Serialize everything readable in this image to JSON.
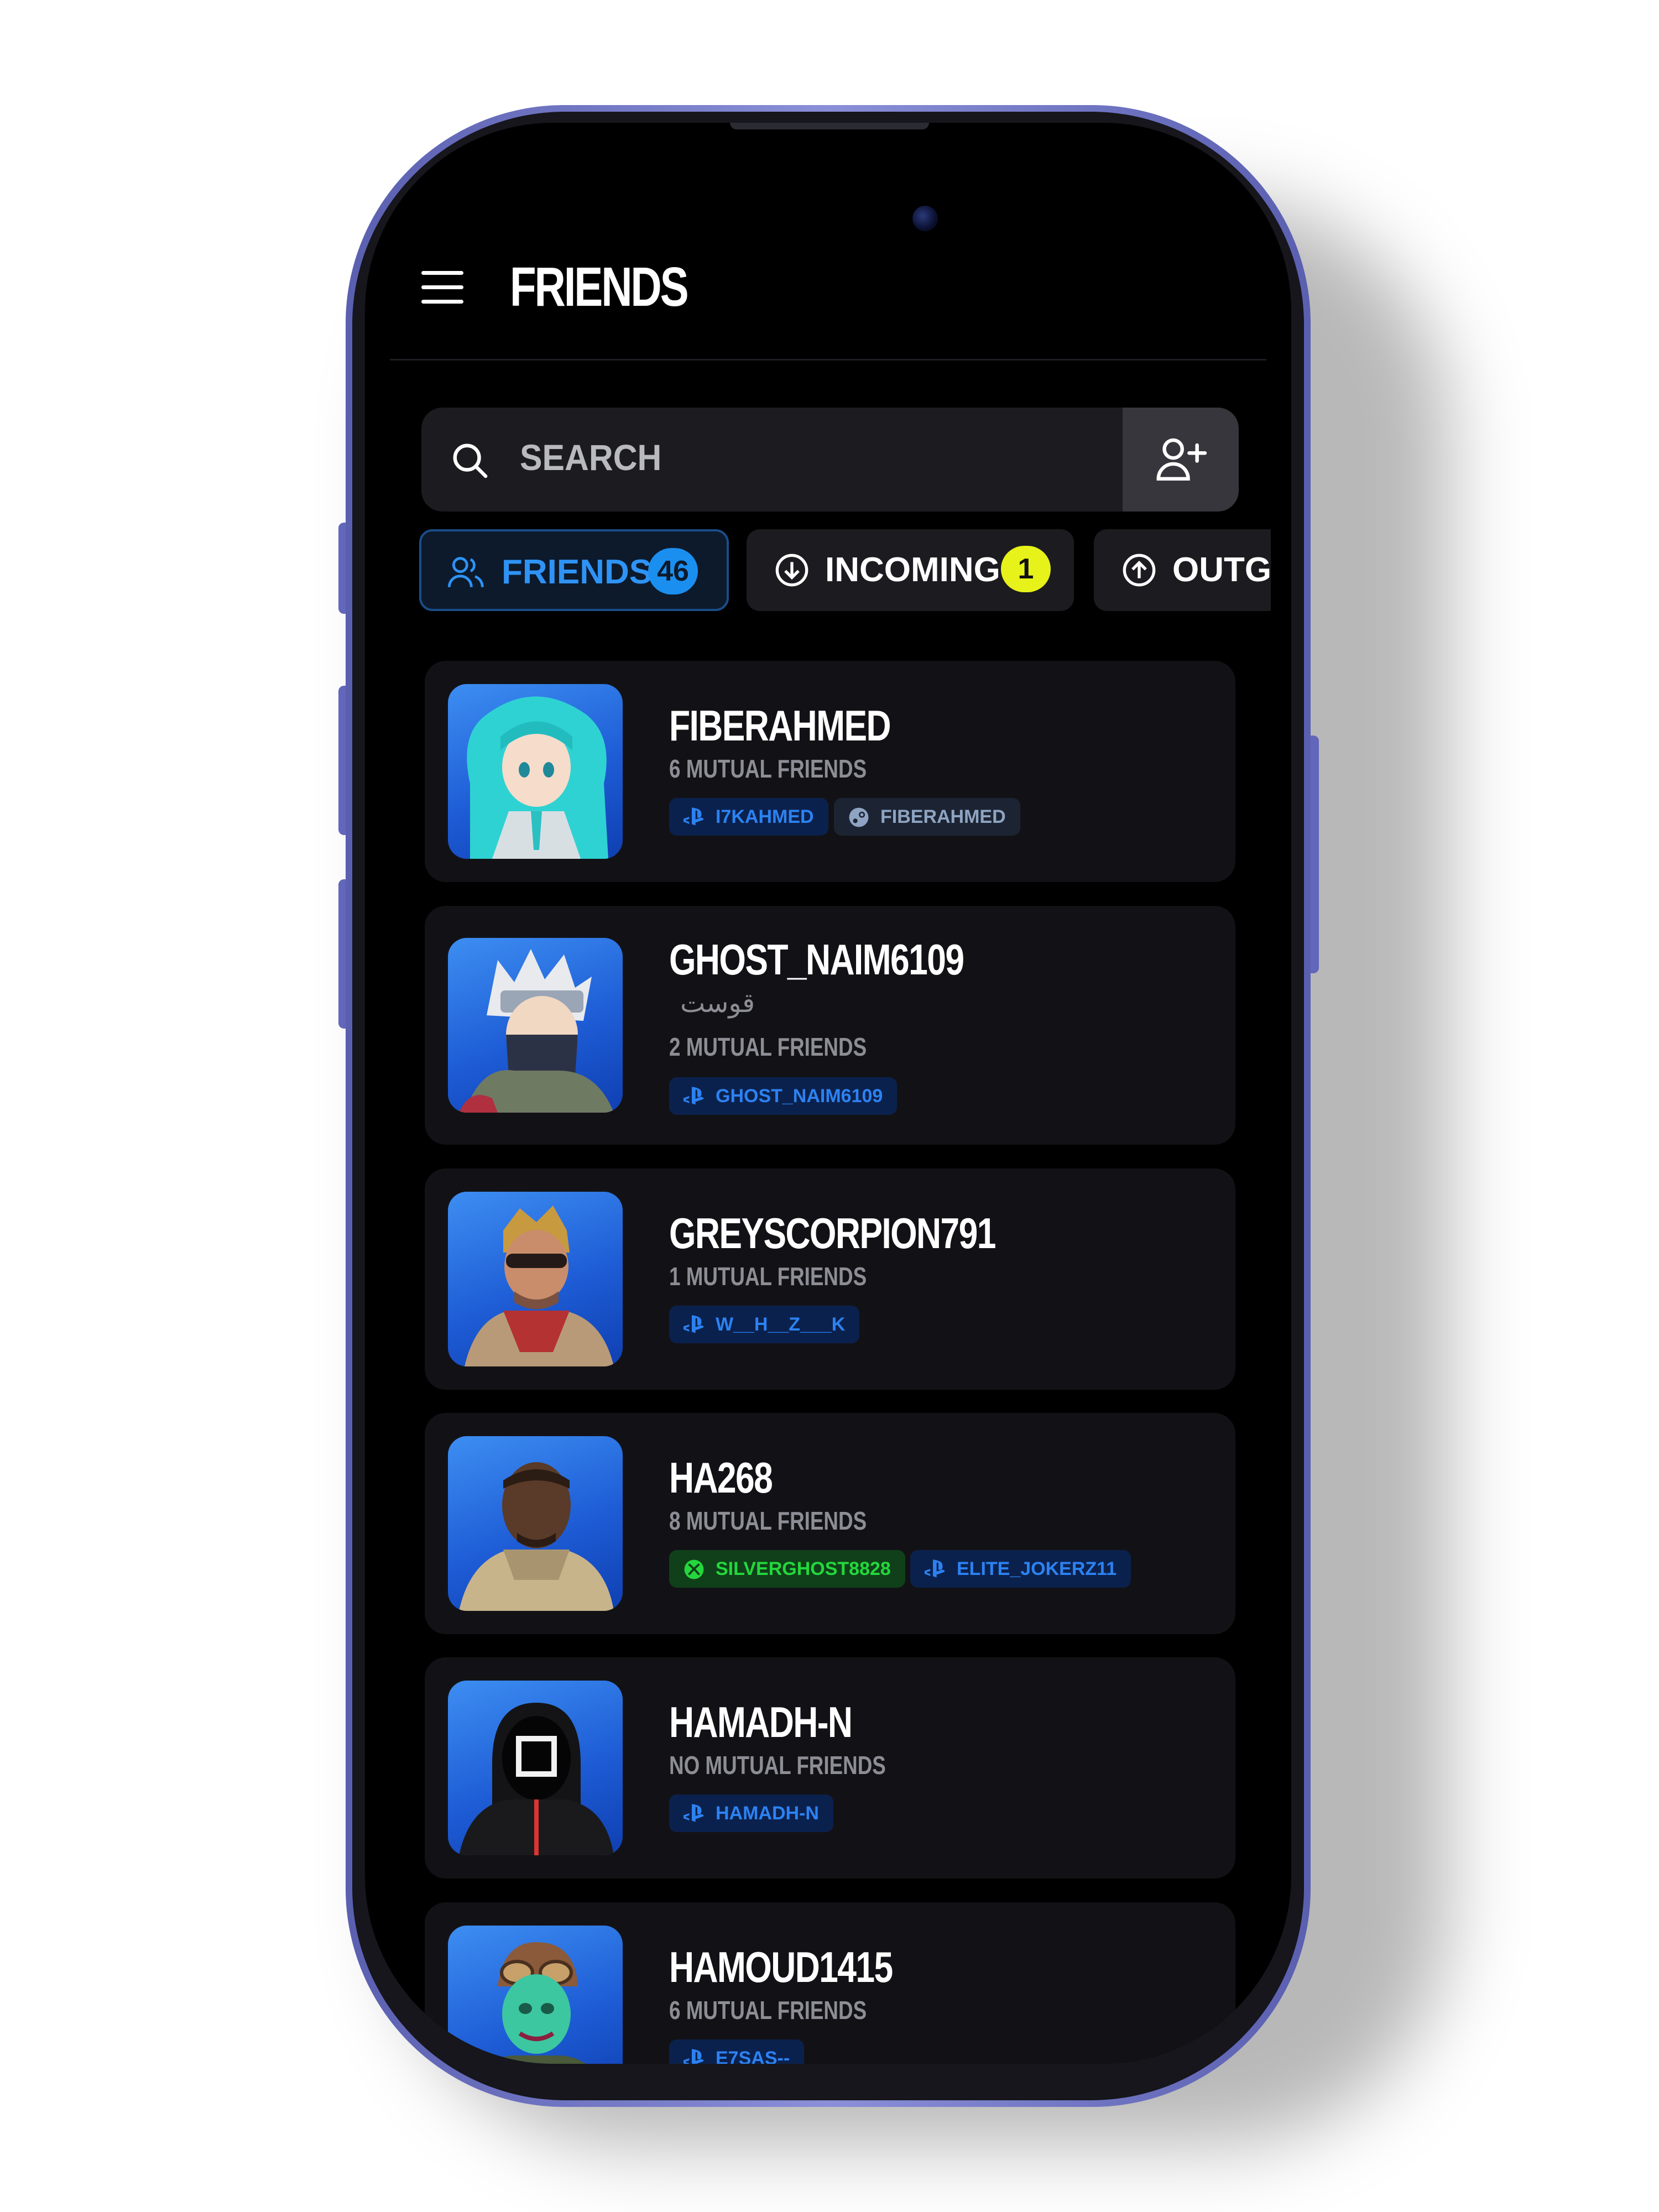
{
  "header": {
    "title": "FRIENDS"
  },
  "search": {
    "placeholder": "SEARCH"
  },
  "tabs": [
    {
      "label": "FRIENDS",
      "count": "46"
    },
    {
      "label": "INCOMING",
      "count": "1"
    },
    {
      "label": "OUTGO"
    }
  ],
  "friends": [
    {
      "name": "FIBERAHMED",
      "mutual": "6 MUTUAL FRIENDS",
      "platforms": [
        {
          "type": "playstation",
          "handle": "I7KAHMED"
        },
        {
          "type": "steam",
          "handle": "FIBERAHMED"
        }
      ]
    },
    {
      "name": "GHOST_NAIM6109",
      "note": "قوست",
      "mutual": "2 MUTUAL FRIENDS",
      "platforms": [
        {
          "type": "playstation",
          "handle": "GHOST_NAIM6109"
        }
      ]
    },
    {
      "name": "GREYSCORPION791",
      "mutual": "1 MUTUAL FRIENDS",
      "platforms": [
        {
          "type": "playstation",
          "handle": "W__H__Z___K"
        }
      ]
    },
    {
      "name": "HA268",
      "mutual": "8 MUTUAL FRIENDS",
      "platforms": [
        {
          "type": "xbox",
          "handle": "SILVERGHOST8828"
        },
        {
          "type": "playstation",
          "handle": "ELITE_JOKERZ11"
        }
      ]
    },
    {
      "name": "HAMADH-N",
      "mutual": "NO MUTUAL FRIENDS",
      "platforms": [
        {
          "type": "playstation",
          "handle": "HAMADH-N"
        }
      ]
    },
    {
      "name": "HAMOUD1415",
      "mutual": "6 MUTUAL FRIENDS",
      "platforms": [
        {
          "type": "playstation",
          "handle": "E7SAS--"
        }
      ]
    }
  ],
  "colors": {
    "accent_blue": "#2e93f5",
    "incoming_badge": "#e6f21a",
    "psn": "#2c82f2",
    "xbox": "#24d73c",
    "steam": "#8ea4c2"
  },
  "icons": {
    "menu": "hamburger-menu-icon",
    "search": "search-icon",
    "add_friend": "add-friend-icon",
    "friends_tab": "friends-icon",
    "incoming_tab": "arrow-down-circle-icon",
    "outgoing_tab": "arrow-up-circle-icon",
    "playstation": "playstation-icon",
    "steam": "steam-icon",
    "xbox": "xbox-icon"
  }
}
